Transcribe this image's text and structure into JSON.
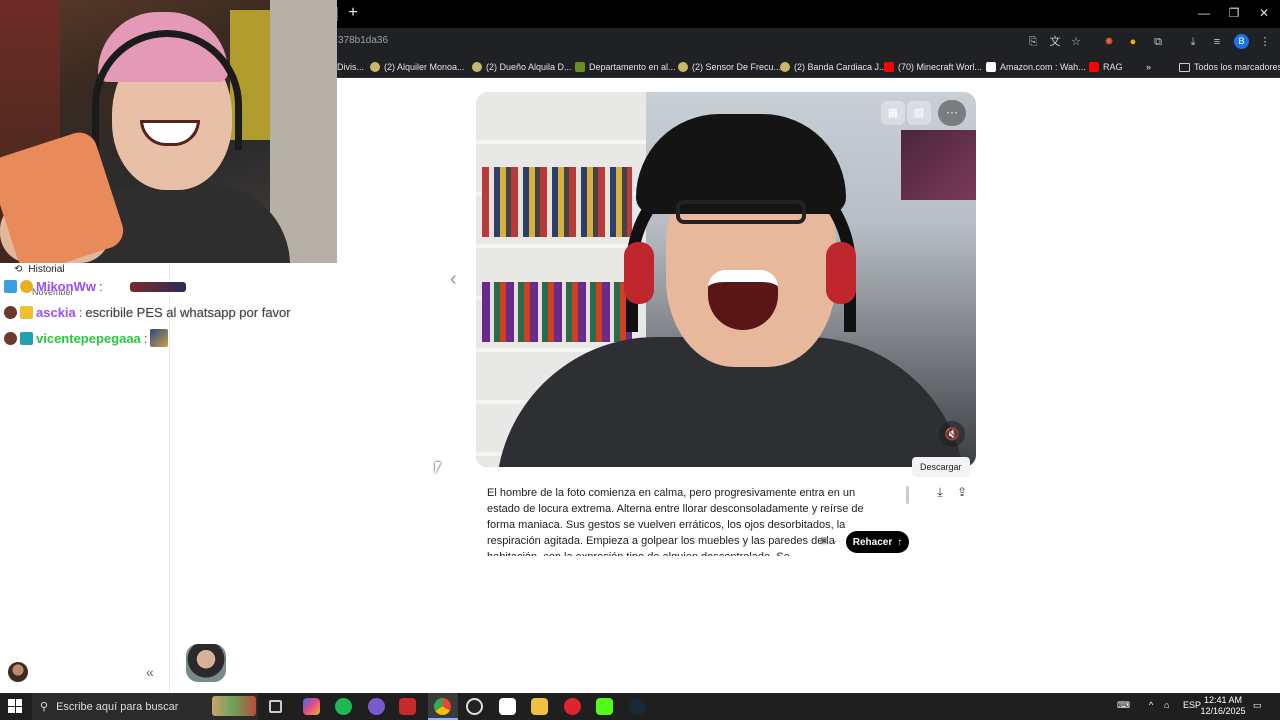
{
  "browser": {
    "url_fragment": "378b1da36",
    "bookmarks": [
      {
        "label": "Divis..."
      },
      {
        "label": "(2) Alquiler Monoa..."
      },
      {
        "label": "(2) Dueño Alquila D..."
      },
      {
        "label": "Departamento en al..."
      },
      {
        "label": "(2) Sensor De Frecu..."
      },
      {
        "label": "(2) Banda Cardiaca J..."
      },
      {
        "label": "(70) Minecraft Worl..."
      },
      {
        "label": "Amazon.com : Wah..."
      },
      {
        "label": "RAG"
      }
    ],
    "more_bookmarks": "»",
    "all_bookmarks": "Todos los marcadores",
    "profile_initial": "B"
  },
  "sidebar": {
    "historial_label": "Historial",
    "month_label": "November",
    "collapse_glyph": "«"
  },
  "chat": [
    {
      "user": "MikonWw",
      "sep": ":",
      "message": "",
      "color": "#9b4dff"
    },
    {
      "user": "asckia",
      "sep": ":",
      "message": "escribile PES al whatsapp por favor",
      "color": "#9b4dff"
    },
    {
      "user": "vicentepepegaaa",
      "sep": ":",
      "message": "",
      "color": "#27c93f"
    }
  ],
  "main": {
    "prev_arrow": "‹",
    "tooltip": "Descargar",
    "prompt": "El hombre de la foto comienza en calma, pero progresivamente entra en un estado de locura extrema. Alterna entre llorar desconsoladamente y reírse de forma maniaca. Sus gestos se vuelven erráticos, los ojos desorbitados, la respiración agitada. Empieza a golpear los muebles y las paredes de la habitación, con la expresión tipo de alguien descontrolado. Se",
    "redo_label": "Rehacer",
    "more_glyph": "···",
    "mute_glyph": "🔇"
  },
  "taskbar": {
    "search_placeholder": "Escribe aquí para buscar",
    "language": "ESP",
    "time": "12:41 AM",
    "date": "12/16/2025"
  },
  "colors": {
    "browser_bg": "#202124",
    "titlebar_bg": "#000000",
    "taskbar_bg": "#1f1f1f",
    "redo_bg": "#000000"
  }
}
